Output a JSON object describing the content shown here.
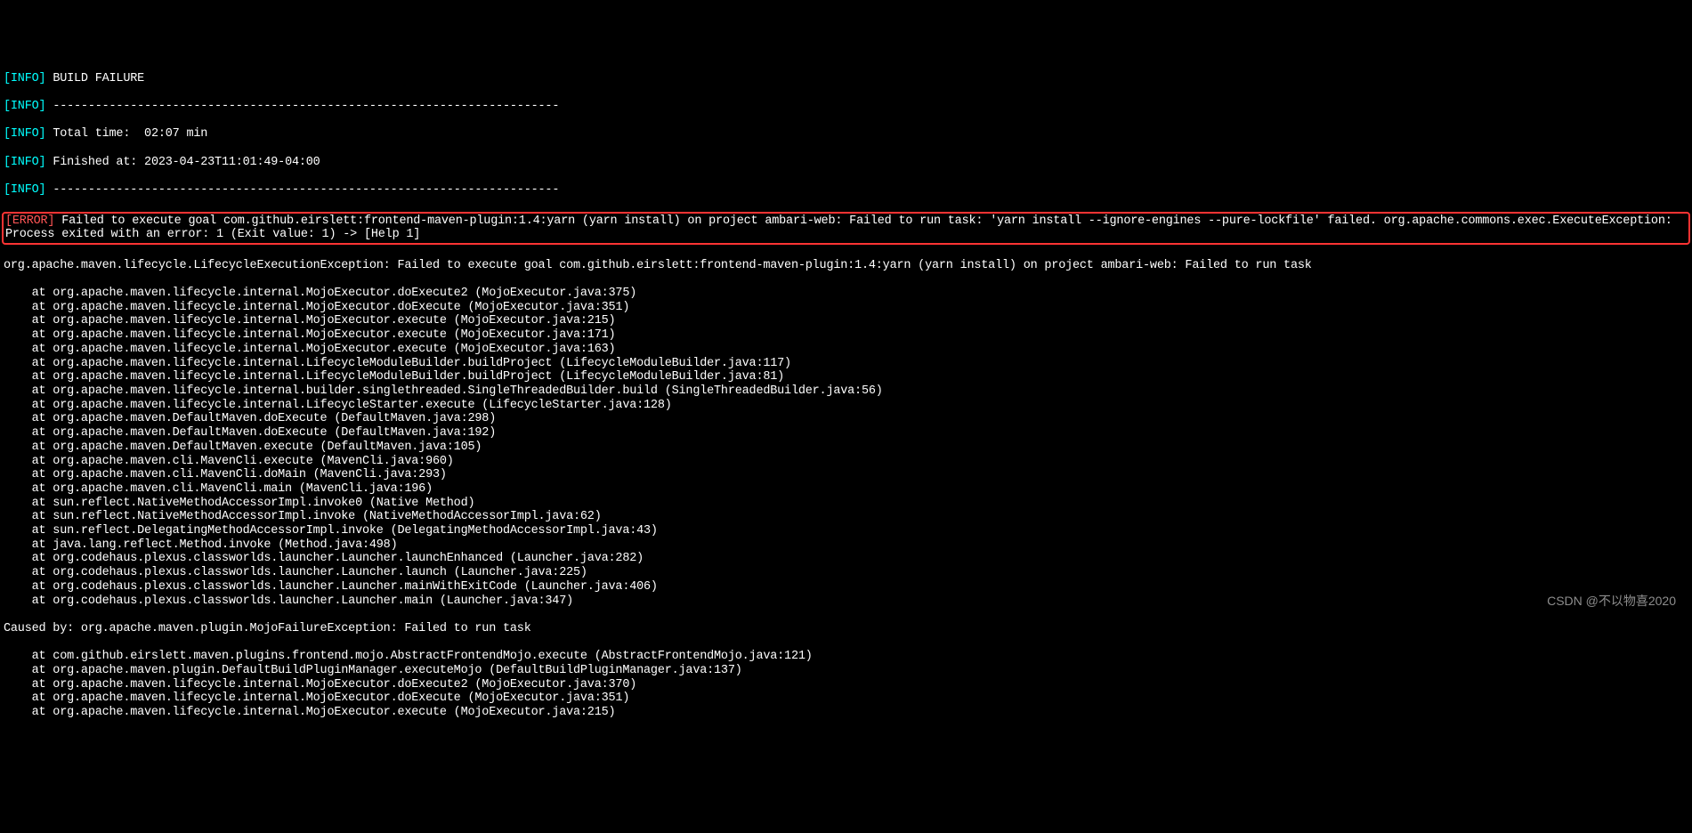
{
  "lines": [
    {
      "type": "info",
      "tag": "[INFO]",
      "text": " BUILD FAILURE"
    },
    {
      "type": "info",
      "tag": "[INFO]",
      "text": " ------------------------------------------------------------------------"
    },
    {
      "type": "info",
      "tag": "[INFO]",
      "text": " Total time:  02:07 min"
    },
    {
      "type": "info",
      "tag": "[INFO]",
      "text": " Finished at: 2023-04-23T11:01:49-04:00"
    },
    {
      "type": "info",
      "tag": "[INFO]",
      "text": " ------------------------------------------------------------------------"
    }
  ],
  "highlighted_error": {
    "tag": "[ERROR]",
    "text": " Failed to execute goal com.github.eirslett:frontend-maven-plugin:1.4:yarn (yarn install) on project ambari-web: Failed to run task: 'yarn install --ignore-engines --pure-lockfile' failed. org.apache.commons.exec.ExecuteException: Process exited with an error: 1 (Exit value: 1) -> [Help 1]"
  },
  "stacktrace_header": "org.apache.maven.lifecycle.LifecycleExecutionException: Failed to execute goal com.github.eirslett:frontend-maven-plugin:1.4:yarn (yarn install) on project ambari-web: Failed to run task",
  "stacktrace": [
    "    at org.apache.maven.lifecycle.internal.MojoExecutor.doExecute2 (MojoExecutor.java:375)",
    "    at org.apache.maven.lifecycle.internal.MojoExecutor.doExecute (MojoExecutor.java:351)",
    "    at org.apache.maven.lifecycle.internal.MojoExecutor.execute (MojoExecutor.java:215)",
    "    at org.apache.maven.lifecycle.internal.MojoExecutor.execute (MojoExecutor.java:171)",
    "    at org.apache.maven.lifecycle.internal.MojoExecutor.execute (MojoExecutor.java:163)",
    "    at org.apache.maven.lifecycle.internal.LifecycleModuleBuilder.buildProject (LifecycleModuleBuilder.java:117)",
    "    at org.apache.maven.lifecycle.internal.LifecycleModuleBuilder.buildProject (LifecycleModuleBuilder.java:81)",
    "    at org.apache.maven.lifecycle.internal.builder.singlethreaded.SingleThreadedBuilder.build (SingleThreadedBuilder.java:56)",
    "    at org.apache.maven.lifecycle.internal.LifecycleStarter.execute (LifecycleStarter.java:128)",
    "    at org.apache.maven.DefaultMaven.doExecute (DefaultMaven.java:298)",
    "    at org.apache.maven.DefaultMaven.doExecute (DefaultMaven.java:192)",
    "    at org.apache.maven.DefaultMaven.execute (DefaultMaven.java:105)",
    "    at org.apache.maven.cli.MavenCli.execute (MavenCli.java:960)",
    "    at org.apache.maven.cli.MavenCli.doMain (MavenCli.java:293)",
    "    at org.apache.maven.cli.MavenCli.main (MavenCli.java:196)",
    "    at sun.reflect.NativeMethodAccessorImpl.invoke0 (Native Method)",
    "    at sun.reflect.NativeMethodAccessorImpl.invoke (NativeMethodAccessorImpl.java:62)",
    "    at sun.reflect.DelegatingMethodAccessorImpl.invoke (DelegatingMethodAccessorImpl.java:43)",
    "    at java.lang.reflect.Method.invoke (Method.java:498)",
    "    at org.codehaus.plexus.classworlds.launcher.Launcher.launchEnhanced (Launcher.java:282)",
    "    at org.codehaus.plexus.classworlds.launcher.Launcher.launch (Launcher.java:225)",
    "    at org.codehaus.plexus.classworlds.launcher.Launcher.mainWithExitCode (Launcher.java:406)",
    "    at org.codehaus.plexus.classworlds.launcher.Launcher.main (Launcher.java:347)"
  ],
  "caused_by": "Caused by: org.apache.maven.plugin.MojoFailureException: Failed to run task",
  "caused_by_stack": [
    "    at com.github.eirslett.maven.plugins.frontend.mojo.AbstractFrontendMojo.execute (AbstractFrontendMojo.java:121)",
    "    at org.apache.maven.plugin.DefaultBuildPluginManager.executeMojo (DefaultBuildPluginManager.java:137)",
    "    at org.apache.maven.lifecycle.internal.MojoExecutor.doExecute2 (MojoExecutor.java:370)",
    "    at org.apache.maven.lifecycle.internal.MojoExecutor.doExecute (MojoExecutor.java:351)",
    "    at org.apache.maven.lifecycle.internal.MojoExecutor.execute (MojoExecutor.java:215)"
  ],
  "watermark": "CSDN @不以物喜2020"
}
